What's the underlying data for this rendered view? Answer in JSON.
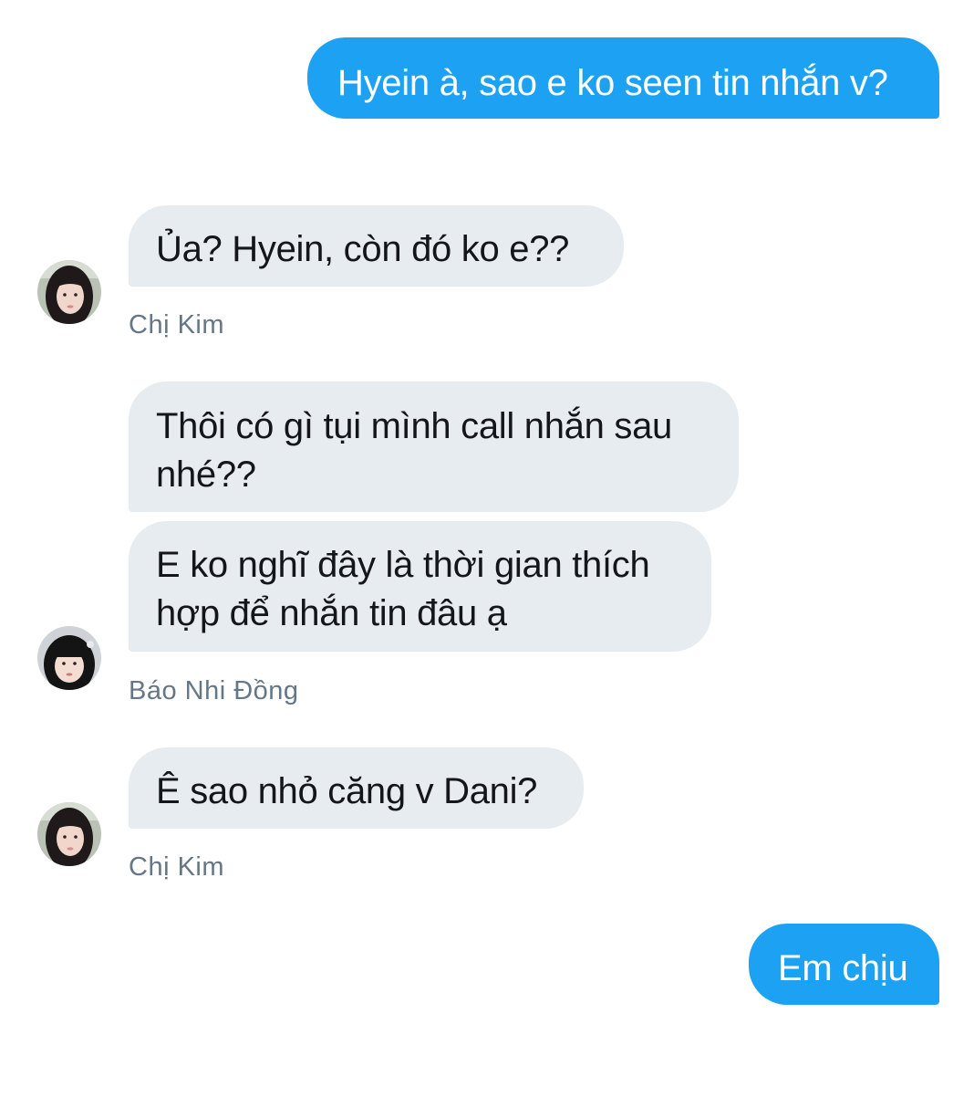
{
  "conversation": {
    "messages": [
      {
        "direction": "outgoing",
        "text": "Hyein à, sao e ko seen tin nhắn v?"
      },
      {
        "direction": "incoming",
        "text": "Ủa? Hyein, còn đó ko e??",
        "sender": "Chị Kim"
      },
      {
        "direction": "incoming",
        "text": "Thôi có gì tụi mình call nhắn sau nhé??",
        "sender": "Báo Nhi Đồng"
      },
      {
        "direction": "incoming",
        "text": "E ko nghĩ đây là thời gian thích hợp để nhắn tin đâu ạ",
        "sender": "Báo Nhi Đồng"
      },
      {
        "direction": "incoming",
        "text": "Ê sao nhỏ căng v Dani?",
        "sender": "Chị Kim"
      },
      {
        "direction": "outgoing",
        "text": "Em chịu"
      }
    ],
    "senders": {
      "kim": "Chị Kim",
      "bao": "Báo Nhi Đồng"
    }
  },
  "colors": {
    "outgoing_bubble": "#1da1f2",
    "incoming_bubble": "#e6ecf0",
    "sender_label": "#657786"
  },
  "icons": {
    "avatar_kim": "avatar-photo",
    "avatar_bao": "avatar-photo"
  }
}
